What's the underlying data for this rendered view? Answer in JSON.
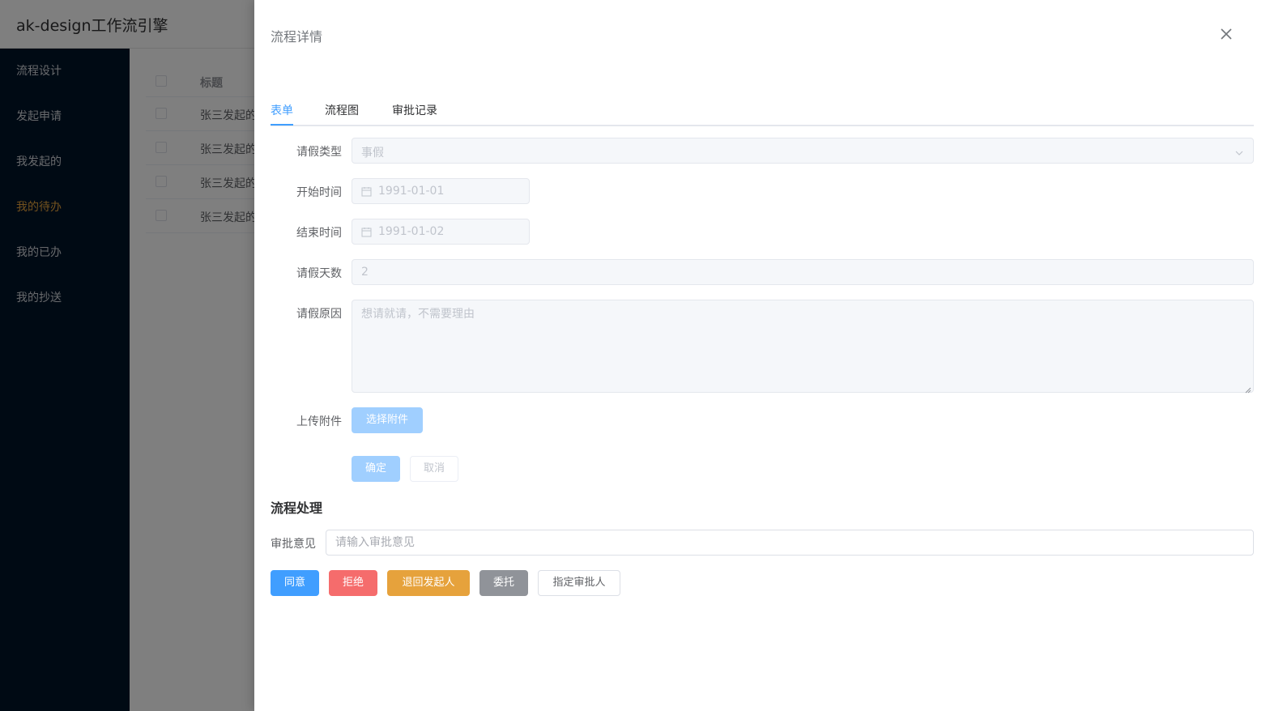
{
  "app": {
    "title": "ak-design工作流引擎",
    "menu": [
      "流程设计",
      "发起申请",
      "我发起的",
      "我的待办",
      "我的已办",
      "我的抄送"
    ],
    "active_menu": "我的待办"
  },
  "bg_table": {
    "header": "标题",
    "rows": [
      "张三发起的",
      "张三发起的",
      "张三发起的",
      "张三发起的"
    ]
  },
  "drawer": {
    "title": "流程详情",
    "tabs": [
      "表单",
      "流程图",
      "审批记录"
    ],
    "active_tab": "表单"
  },
  "form": {
    "leave_type_label": "请假类型",
    "leave_type_value": "事假",
    "start_label": "开始时间",
    "start_value": "1991-01-01",
    "end_label": "结束时间",
    "end_value": "1991-01-02",
    "days_label": "请假天数",
    "days_value": "2",
    "reason_label": "请假原因",
    "reason_value": "想请就请，不需要理由",
    "attach_label": "上传附件",
    "attach_button": "选择附件",
    "confirm_button": "确定",
    "cancel_button": "取消"
  },
  "process": {
    "section_title": "流程处理",
    "opinion_label": "审批意见",
    "opinion_placeholder": "请输入审批意见",
    "agree": "同意",
    "reject": "拒绝",
    "return": "退回发起人",
    "delegate": "委托",
    "assign": "指定审批人"
  },
  "colors": {
    "primary": "#409eff",
    "danger": "#f56c6c",
    "warning": "#e6a23c",
    "info": "#909399",
    "sidebar": "#001529",
    "active_menu": "#e6a23c"
  }
}
